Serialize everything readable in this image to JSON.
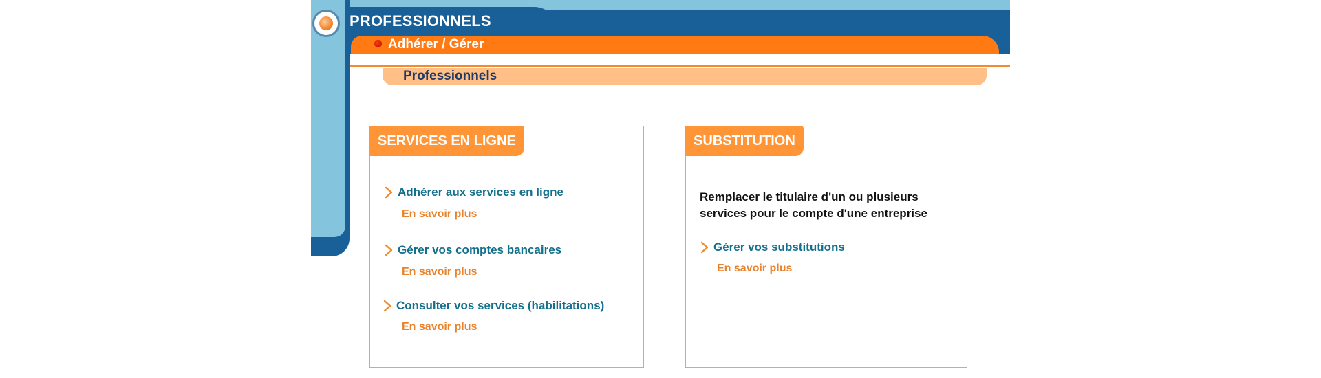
{
  "header": {
    "title": "PROFESSIONNELS",
    "nav_label": "Adhérer / Gérer",
    "sub_label": "Professionnels"
  },
  "colors": {
    "light_blue": "#84c4dd",
    "dark_blue": "#195f98",
    "orange": "#ff7a12",
    "peach": "#ffbf86",
    "tab_orange": "#ff9537",
    "link_teal": "#13708c",
    "more_orange": "#e8822c"
  },
  "services": {
    "tab_label": "SERVICES EN LIGNE",
    "items": [
      {
        "label": "Adhérer aux services en ligne",
        "more": "En savoir plus"
      },
      {
        "label": "Gérer vos comptes bancaires",
        "more": "En savoir plus"
      },
      {
        "label": "Consulter vos services (habilitations)",
        "more": "En savoir plus"
      }
    ]
  },
  "substitution": {
    "tab_label": "SUBSTITUTION",
    "description_line1": "Remplacer le titulaire d'un ou plusieurs",
    "description_line2": "services pour le compte d'une entreprise",
    "items": [
      {
        "label": "Gérer vos substitutions",
        "more": "En savoir plus"
      }
    ]
  },
  "icons": {
    "link_arrow": "chevron-right-icon",
    "header_logo": "orange-circle-logo"
  }
}
